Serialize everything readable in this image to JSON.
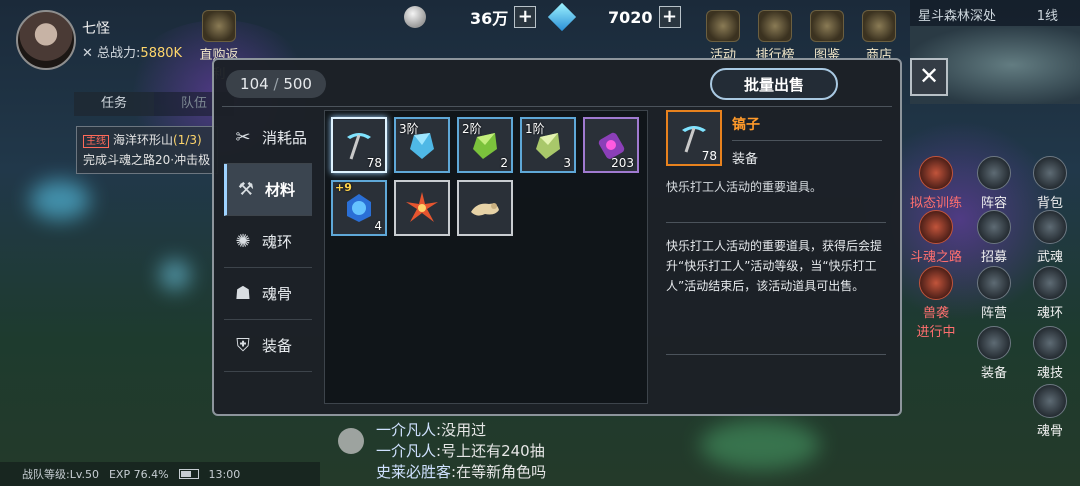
{
  "player": {
    "name": "七怪",
    "power_label": "总战力:",
    "power_value": "5880K",
    "gift_label": "直购返利"
  },
  "currencies": {
    "silver": "36万",
    "diamond": "7020",
    "plus": "+"
  },
  "top_menu": [
    {
      "label": "活动",
      "icon": "activity-icon"
    },
    {
      "label": "排行榜",
      "icon": "trophy-icon"
    },
    {
      "label": "图鉴",
      "icon": "book-icon"
    },
    {
      "label": "商店",
      "icon": "shop-icon"
    }
  ],
  "map": {
    "title": "星斗森林深处",
    "line": "1线"
  },
  "task_tabs": [
    "任务",
    "队伍"
  ],
  "quest": {
    "tag": "主线",
    "title": "海洋环形山",
    "progress": "(1/3)",
    "desc": "完成斗魂之路20·冲击极"
  },
  "right_icons": [
    {
      "label": "拟态训练",
      "icon": "training-icon",
      "red": true
    },
    {
      "label": "阵容",
      "icon": "lineup-icon",
      "red": false
    },
    {
      "label": "背包",
      "icon": "backpack-icon",
      "red": false
    },
    {
      "label": "斗魂之路",
      "icon": "soul-road-icon",
      "red": true
    },
    {
      "label": "招募",
      "icon": "recruit-icon",
      "red": false
    },
    {
      "label": "武魂",
      "icon": "martial-soul-icon",
      "red": false
    },
    {
      "label": "兽袭",
      "icon": "beast-raid-icon",
      "red": true
    },
    {
      "label": "阵营",
      "icon": "camp-icon",
      "red": false
    },
    {
      "label": "魂环",
      "icon": "soul-ring-icon",
      "red": false
    },
    {
      "label": "装备",
      "icon": "equipment-icon",
      "red": false
    },
    {
      "label": "魂技",
      "icon": "soul-skill-icon",
      "red": false
    },
    {
      "label": "魂骨",
      "icon": "soul-bone-icon",
      "red": false
    }
  ],
  "beast_raid_status": "进行中",
  "chat": [
    {
      "name": "一介凡人",
      "msg": "没用过"
    },
    {
      "name": "一介凡人",
      "msg": "号上还有240抽"
    },
    {
      "name": "史莱必胜客",
      "msg": "在等新角色吗"
    }
  ],
  "status_bar": {
    "level": "战队等级:Lv.50",
    "exp": "EXP 76.4%",
    "time": "13:00"
  },
  "inventory": {
    "used": "104",
    "sep": "/",
    "capacity": "500",
    "bulk_sell": "批量出售",
    "close": "✕",
    "categories": [
      {
        "label": "消耗品",
        "icon": "consumable-icon",
        "glyph": "✂",
        "active": false
      },
      {
        "label": "材料",
        "icon": "material-icon",
        "glyph": "⚒",
        "active": true
      },
      {
        "label": "魂环",
        "icon": "soul-ring-icon",
        "glyph": "✺",
        "active": false
      },
      {
        "label": "魂骨",
        "icon": "soul-bone-icon",
        "glyph": "☗",
        "active": false
      },
      {
        "label": "装备",
        "icon": "equipment-icon",
        "glyph": "⛨",
        "active": false
      }
    ],
    "items": [
      {
        "name": "pickaxe",
        "count": "78",
        "tier": "",
        "plus": "",
        "quality": "white",
        "selected": true,
        "art": "pickaxe"
      },
      {
        "name": "blue-crystal",
        "count": "",
        "tier": "3阶",
        "plus": "",
        "quality": "blue",
        "selected": false,
        "art": "crystal-blue"
      },
      {
        "name": "green-crystal",
        "count": "2",
        "tier": "2阶",
        "plus": "",
        "quality": "blue",
        "selected": false,
        "art": "crystal-green"
      },
      {
        "name": "pale-crystal",
        "count": "3",
        "tier": "1阶",
        "plus": "",
        "quality": "blue",
        "selected": false,
        "art": "crystal-pale"
      },
      {
        "name": "purple-scroll",
        "count": "203",
        "tier": "",
        "plus": "",
        "quality": "purple",
        "selected": false,
        "art": "scroll"
      },
      {
        "name": "blue-gem",
        "count": "4",
        "tier": "",
        "plus": "+9",
        "quality": "blue",
        "selected": false,
        "art": "gem"
      },
      {
        "name": "red-flower",
        "count": "",
        "tier": "",
        "plus": "",
        "quality": "white",
        "selected": false,
        "art": "flower"
      },
      {
        "name": "beige-bone",
        "count": "",
        "tier": "",
        "plus": "",
        "quality": "white",
        "selected": false,
        "art": "bone"
      }
    ],
    "detail": {
      "name": "镐子",
      "count": "78",
      "type": "装备",
      "short_desc": "快乐打工人活动的重要道具。",
      "long_desc": "快乐打工人活动的重要道具，获得后会提升“快乐打工人”活动等级，当“快乐打工人”活动结束后，该活动道具可出售。"
    }
  },
  "colors": {
    "accent": "#9fd3ff",
    "selected_name": "#ff9a2a",
    "power": "#ffd66b"
  }
}
